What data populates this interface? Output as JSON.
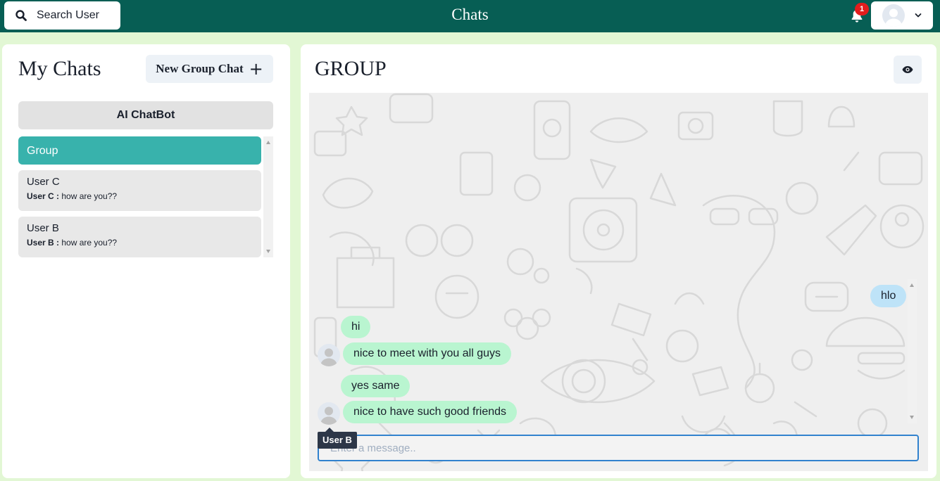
{
  "header": {
    "search_label": "Search User",
    "title": "Chats",
    "notification_count": "1",
    "icons": {
      "search": "search-icon",
      "bell": "bell-icon",
      "avatar": "user-avatar",
      "menu": "chevron-down-icon"
    }
  },
  "sidebar": {
    "title": "My Chats",
    "new_group_label": "New Group Chat",
    "ai_chatbot_label": "AI ChatBot",
    "chats": [
      {
        "name": "Group",
        "active": true
      },
      {
        "name": "User C",
        "last_sender": "User C :",
        "last_message": "how are you??"
      },
      {
        "name": "User B",
        "last_sender": "User B :",
        "last_message": "how are you??"
      }
    ]
  },
  "chat": {
    "title": "GROUP",
    "view_icon": "eye-icon",
    "messages": [
      {
        "text": "hlo",
        "mine": true
      },
      {
        "text": "hi",
        "mine": false
      },
      {
        "text": "nice to meet with you all guys",
        "mine": false,
        "show_avatar": true
      },
      {
        "text": "yes same",
        "mine": false
      },
      {
        "text": "nice to have such good friends",
        "mine": false,
        "show_avatar": true
      }
    ],
    "tooltip": "User B",
    "input_placeholder": "Enter a message.."
  },
  "colors": {
    "header_bg": "#075e54",
    "page_bg": "#e2f7d4",
    "active_chat": "#38b2ac",
    "received_bubble": "#b9f5d0",
    "sent_bubble": "#bee3f8",
    "badge": "#e11d1d",
    "input_border": "#3182ce"
  }
}
